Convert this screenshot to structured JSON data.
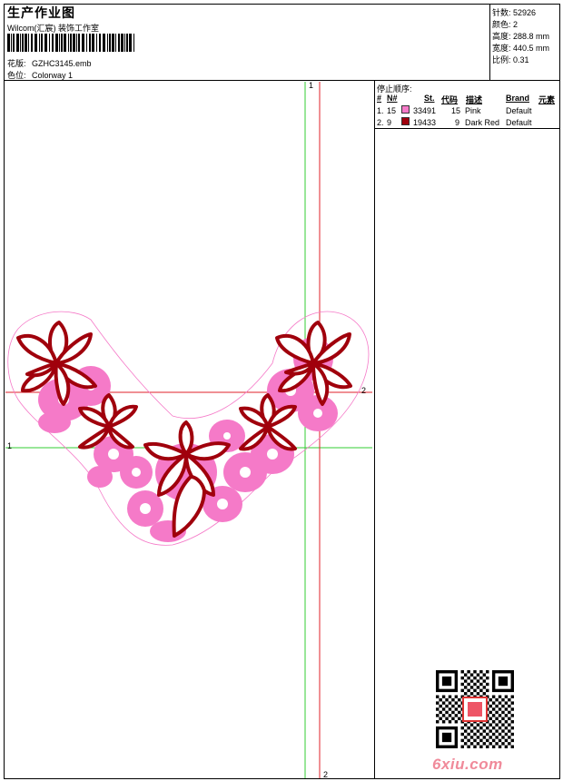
{
  "header": {
    "title": "生产作业图",
    "subtitle": "Wilcom(汇宸) 装饰工作室",
    "design_label": "花版:",
    "design_value": "GZHC3145.emb",
    "colorway_label": "色位:",
    "colorway_value": "Colorway 1"
  },
  "meta": {
    "stitches": {
      "label": "针数:",
      "value": "52926"
    },
    "colors": {
      "label": "颜色:",
      "value": "2"
    },
    "height": {
      "label": "高度:",
      "value": "288.8 mm"
    },
    "width": {
      "label": "宽度:",
      "value": "440.5 mm"
    },
    "scale": {
      "label": "比例:",
      "value": "0.31"
    }
  },
  "sequence": {
    "title": "停止顺序:",
    "headers": {
      "num": "#",
      "no": "N#",
      "st": "St.",
      "code": "代码",
      "desc": "描述",
      "brand": "Brand",
      "element": "元素"
    },
    "rows": [
      {
        "num": "1.",
        "no": "15",
        "code": "33491",
        "st": "15",
        "desc": "Pink",
        "brand": "Default",
        "color": "#f57ac8"
      },
      {
        "num": "2.",
        "no": "9",
        "code": "19433",
        "st": "9",
        "desc": "Dark Red",
        "brand": "Default",
        "color": "#a0000c"
      }
    ]
  },
  "guides": {
    "green_h": "1",
    "green_v": "1",
    "red_h": "2",
    "red_v": "2"
  },
  "watermark": {
    "site": "6xiu.com",
    "qr_icon": "qr-code-icon"
  },
  "colors": {
    "pink": "#f57ac8",
    "dark_red": "#a0000c",
    "guide_green": "#33cc33",
    "guide_red": "#e0202a"
  }
}
